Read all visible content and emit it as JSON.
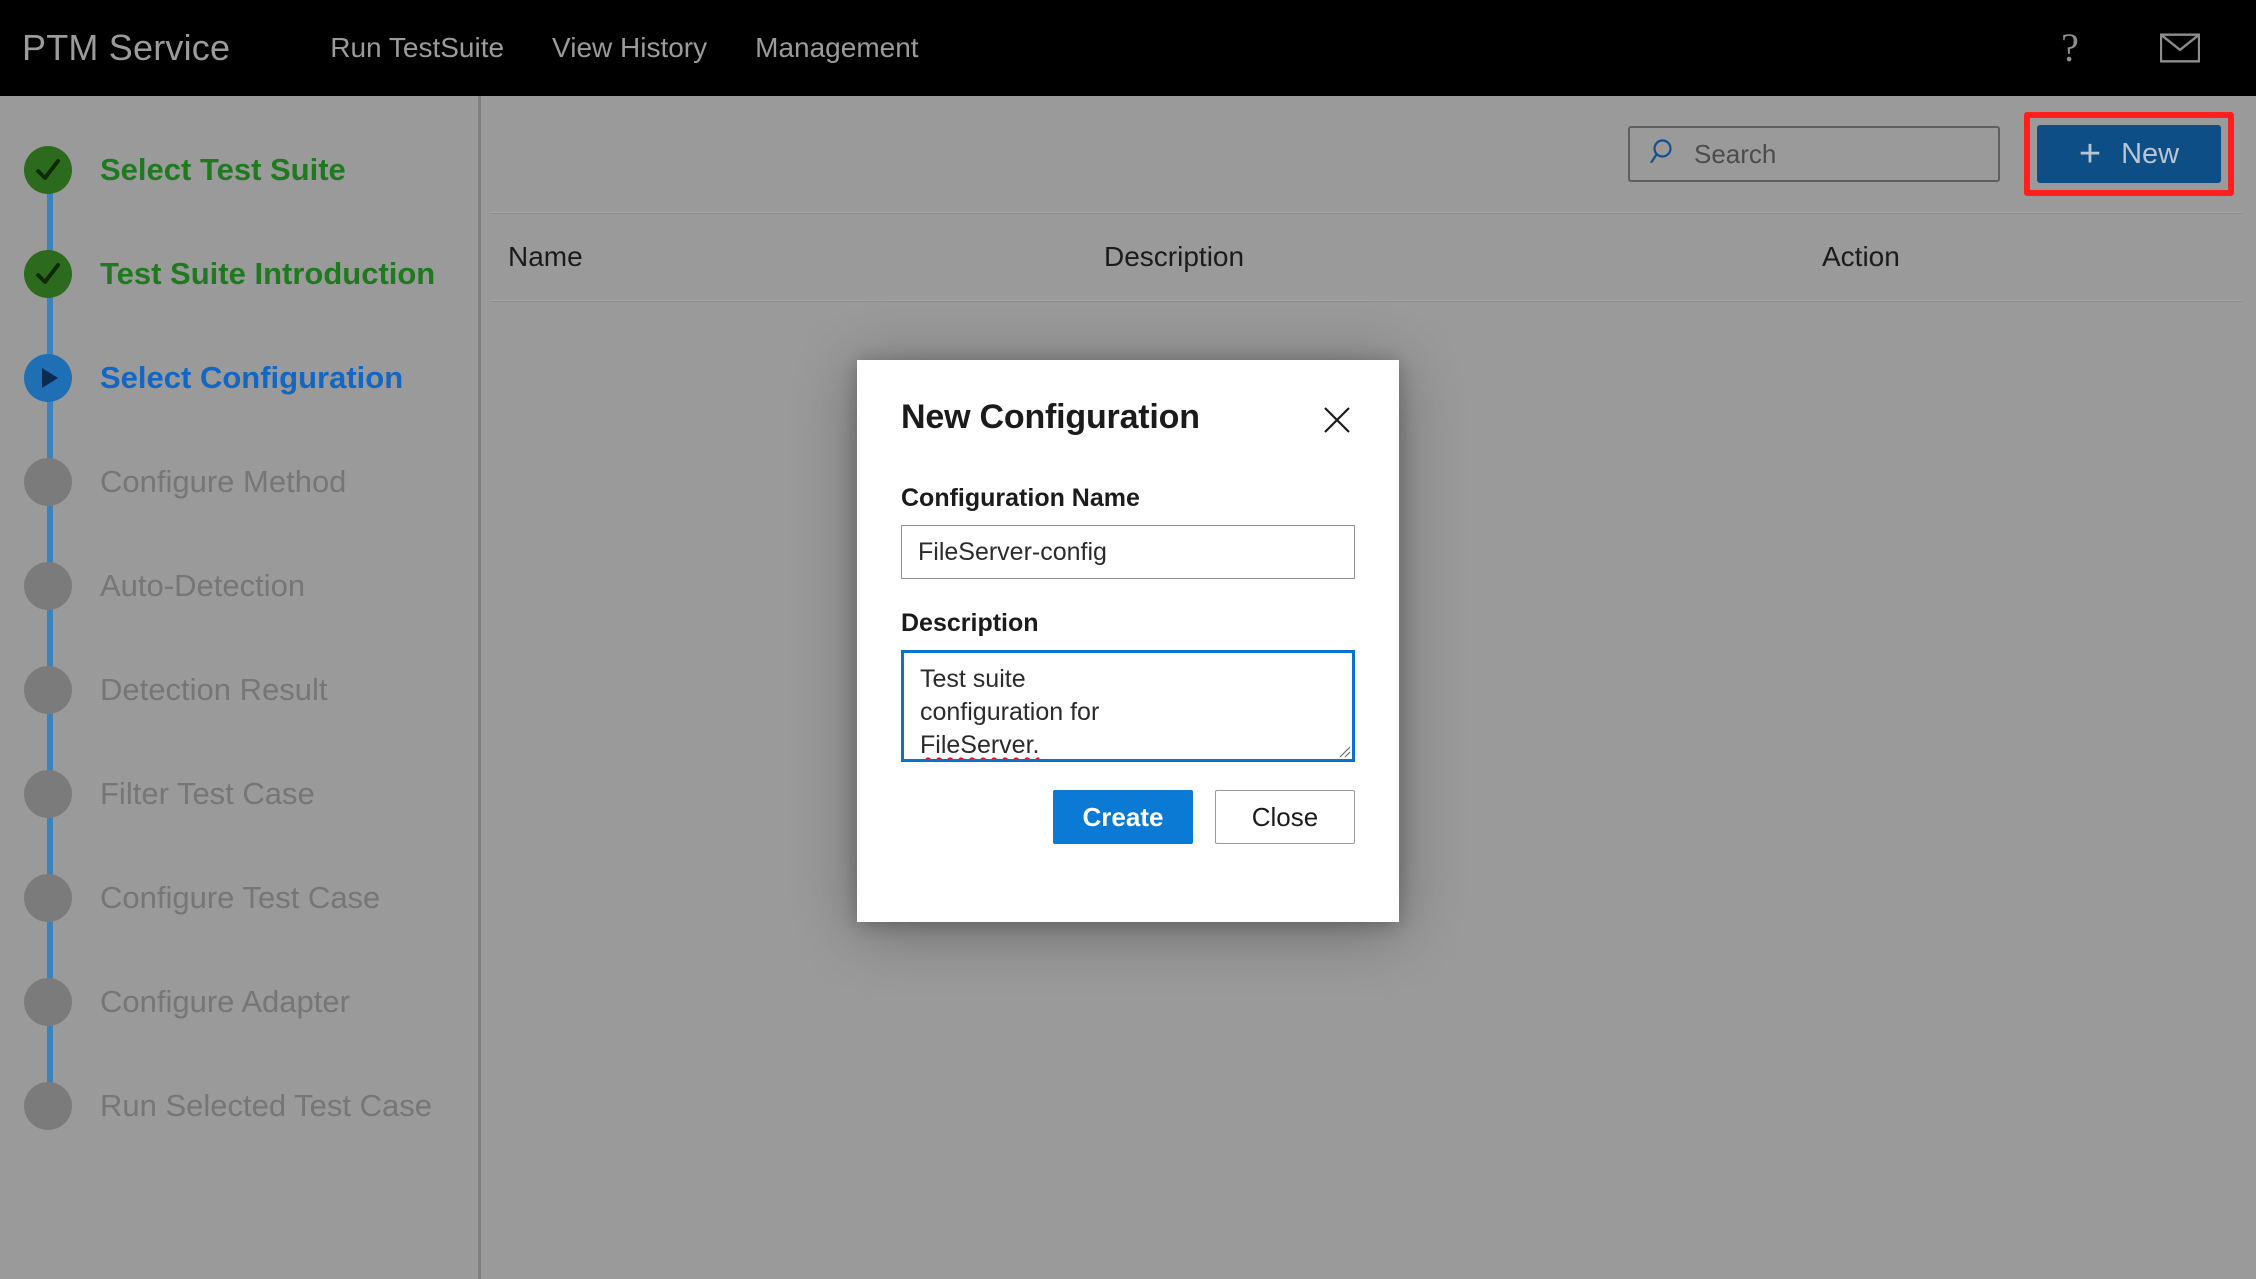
{
  "header": {
    "brand": "PTM Service",
    "nav": [
      {
        "label": "Run TestSuite"
      },
      {
        "label": "View History"
      },
      {
        "label": "Management"
      }
    ],
    "help_icon": "help-question-icon",
    "help_glyph": "?",
    "mail_icon": "mail-envelope-icon"
  },
  "sidebar": {
    "steps": [
      {
        "label": "Select Test Suite",
        "state": "done",
        "icon": "check-icon"
      },
      {
        "label": "Test Suite Introduction",
        "state": "done",
        "icon": "check-icon"
      },
      {
        "label": "Select Configuration",
        "state": "active",
        "icon": "play-icon"
      },
      {
        "label": "Configure Method",
        "state": "pending",
        "icon": "circle-icon"
      },
      {
        "label": "Auto-Detection",
        "state": "pending",
        "icon": "circle-icon"
      },
      {
        "label": "Detection Result",
        "state": "pending",
        "icon": "circle-icon"
      },
      {
        "label": "Filter Test Case",
        "state": "pending",
        "icon": "circle-icon"
      },
      {
        "label": "Configure Test Case",
        "state": "pending",
        "icon": "circle-icon"
      },
      {
        "label": "Configure Adapter",
        "state": "pending",
        "icon": "circle-icon"
      },
      {
        "label": "Run Selected Test Case",
        "state": "pending",
        "icon": "circle-icon"
      }
    ]
  },
  "toolbar": {
    "search_placeholder": "Search",
    "search_value": "",
    "search_icon": "search-magnifier-icon",
    "new_label": "New",
    "new_plus": "+",
    "new_icon": "plus-icon",
    "highlight_color": "#ff1f1f"
  },
  "table": {
    "columns": [
      "Name",
      "Description",
      "Action"
    ],
    "rows": []
  },
  "modal": {
    "title": "New Configuration",
    "close_icon": "close-x-icon",
    "name_label": "Configuration Name",
    "name_value": "FileServer-config",
    "description_label": "Description",
    "description_line1": "Test suite configuration for",
    "description_line2": "FileServer.",
    "create_label": "Create",
    "close_label": "Close"
  },
  "colors": {
    "accent_blue": "#0a7ad4",
    "new_button_blue": "#0d4e87",
    "step_done_green": "#2c6b1e",
    "step_active_blue": "#1f6fb5",
    "step_pending_gray": "#7b7b7b",
    "connector_blue": "#3d82bd",
    "highlight_red": "#ff1f1f",
    "page_background": "#9a9a9a",
    "topbar_background": "#000000"
  }
}
